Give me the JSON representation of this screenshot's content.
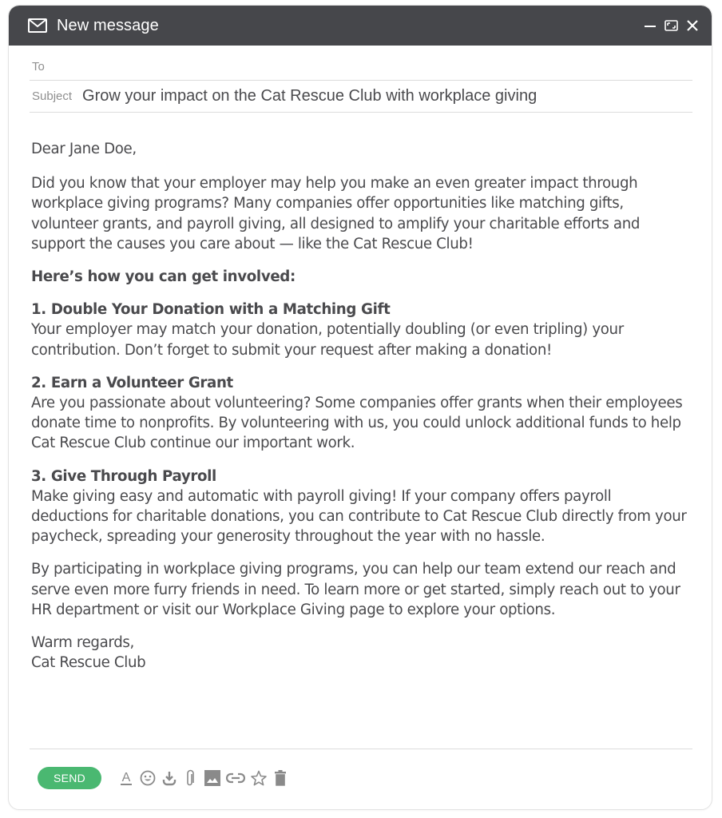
{
  "window": {
    "title": "New message",
    "controls": {
      "minimize_icon": "minimize-icon",
      "maximize_icon": "maximize-icon",
      "close_icon": "close-icon"
    }
  },
  "fields": {
    "to_label": "To",
    "to_value": "",
    "subject_label": "Subject",
    "subject_value": "Grow your impact on the Cat Rescue Club with workplace giving"
  },
  "body": {
    "greeting": "Dear Jane Doe,",
    "intro": "Did you know that your employer may help you make an even greater impact through workplace giving programs? Many companies offer opportunities like matching gifts, volunteer grants, and payroll giving, all designed to amplify your charitable efforts and support the causes you care about — like the Cat Rescue Club!",
    "involved_heading": "Here’s how you can get involved:",
    "sections": [
      {
        "heading": "1. Double Your Donation with a Matching Gift",
        "text": "Your employer may match your donation, potentially doubling (or even tripling) your contribution. Don’t forget to submit your request after making a donation!"
      },
      {
        "heading": "2. Earn a Volunteer Grant",
        "text": "Are you passionate about volunteering? Some companies offer grants when their employees donate time to nonprofits. By volunteering with us, you could unlock additional funds to help Cat Rescue Club continue our important work."
      },
      {
        "heading": "3. Give Through Payroll",
        "text": "Make giving easy and automatic with payroll giving! If your company offers payroll deductions for charitable donations, you can contribute to Cat Rescue Club directly from your paycheck, spreading your generosity throughout the year with no hassle."
      }
    ],
    "closing_paragraph": "By participating in workplace giving programs, you can help our team extend our reach and serve even more furry friends in need. To learn more or get started, simply reach out to your HR department or visit our Workplace Giving page to explore your options.",
    "signoff": "Warm regards,",
    "signature": "Cat Rescue Club"
  },
  "footer": {
    "send_label": "SEND",
    "send_color": "#4ab871",
    "tools": [
      "text-format-icon",
      "emoji-icon",
      "download-icon",
      "attachment-icon",
      "image-icon",
      "link-icon",
      "star-icon",
      "trash-icon"
    ]
  },
  "colors": {
    "titlebar": "#46474b",
    "text": "#4a4a4d",
    "label": "#8f8f8f",
    "icon": "#8a8a8a"
  }
}
